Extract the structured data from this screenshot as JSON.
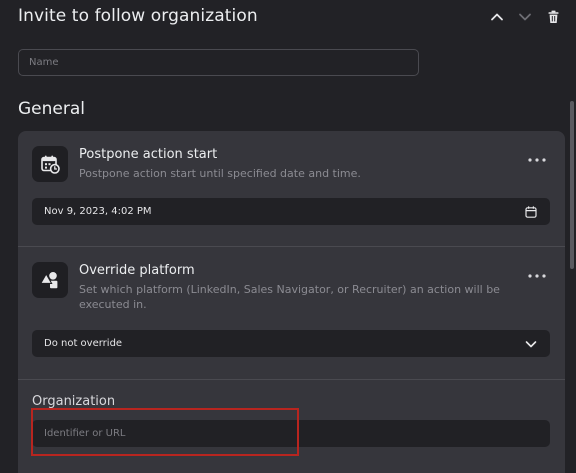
{
  "header": {
    "title": "Invite to follow organization"
  },
  "name_field": {
    "placeholder": "Name"
  },
  "section": {
    "title": "General"
  },
  "cards": {
    "postpone": {
      "title": "Postpone action start",
      "description": "Postpone action start until specified date and time.",
      "value": "Nov 9, 2023, 4:02 PM",
      "icon": "calendar-clock-icon",
      "field_icon": "calendar-icon"
    },
    "platform": {
      "title": "Override platform",
      "description": "Set which platform (LinkedIn, Sales Navigator, or Recruiter) an action will be executed in.",
      "value": "Do not override",
      "icon": "shapes-icon",
      "field_icon": "chevron-down-icon"
    },
    "organization": {
      "label": "Organization",
      "placeholder": "Identifier or URL"
    }
  },
  "colors": {
    "background": "#222226",
    "panel": "#36363c",
    "field": "#212125",
    "highlight": "#b8251f"
  }
}
